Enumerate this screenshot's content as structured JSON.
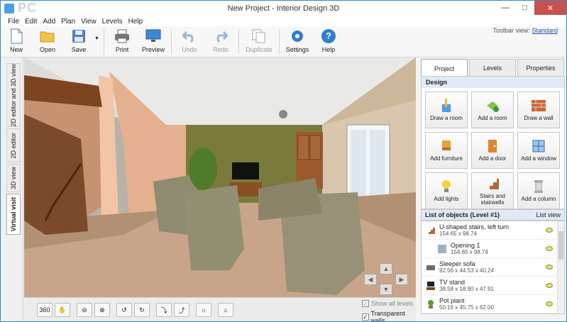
{
  "window": {
    "title": "New Project - Interior Design 3D",
    "watermark": "PC",
    "controls": {
      "minimize": "—",
      "maximize": "□",
      "close": "✕"
    }
  },
  "menu": [
    "File",
    "Edit",
    "Add",
    "Plan",
    "View",
    "Levels",
    "Help"
  ],
  "toolbar": {
    "new": "New",
    "open": "Open",
    "save": "Save",
    "print": "Print",
    "preview": "Preview",
    "undo": "Undo",
    "redo": "Redo",
    "duplicate": "Duplicate",
    "settings": "Settings",
    "help": "Help",
    "view_label": "Toolbar view:",
    "view_value": "Standard"
  },
  "left_tabs": [
    "2D editor and 3D view",
    "2D editor",
    "3D view",
    "Virtual visit"
  ],
  "right_tabs": [
    "Project",
    "Levels",
    "Properties"
  ],
  "design": {
    "title": "Design",
    "buttons": [
      {
        "label": "Draw a room",
        "icon": "pencil-icon"
      },
      {
        "label": "Add a room",
        "icon": "add-room-icon"
      },
      {
        "label": "Draw a wall",
        "icon": "brick-wall-icon"
      },
      {
        "label": "Add furniture",
        "icon": "furniture-icon"
      },
      {
        "label": "Add a door",
        "icon": "door-icon"
      },
      {
        "label": "Add a window",
        "icon": "window-icon"
      },
      {
        "label": "Add lights",
        "icon": "bulb-icon"
      },
      {
        "label": "Stairs and stairwells",
        "icon": "stairs-icon"
      },
      {
        "label": "Add a column",
        "icon": "column-icon"
      }
    ]
  },
  "objects": {
    "title": "List of objects (Level #1)",
    "view_link": "List view",
    "items": [
      {
        "name": "U-shaped stairs, left turn",
        "dims": "154.65 x 98.74"
      },
      {
        "name": "Opening 1",
        "dims": "154.65 x 98.74"
      },
      {
        "name": "Sleeper sofa",
        "dims": "92.56 x 44.53 x 40.24"
      },
      {
        "name": "TV stand",
        "dims": "38.58 x 18.90 x 47.91"
      },
      {
        "name": "Pot plant",
        "dims": "50.16 x 45.75 x 62.00"
      }
    ]
  },
  "bottom": {
    "buttons": [
      "360"
    ],
    "show_all_levels": "Show all levels",
    "transparent_walls": "Transparent walls"
  }
}
